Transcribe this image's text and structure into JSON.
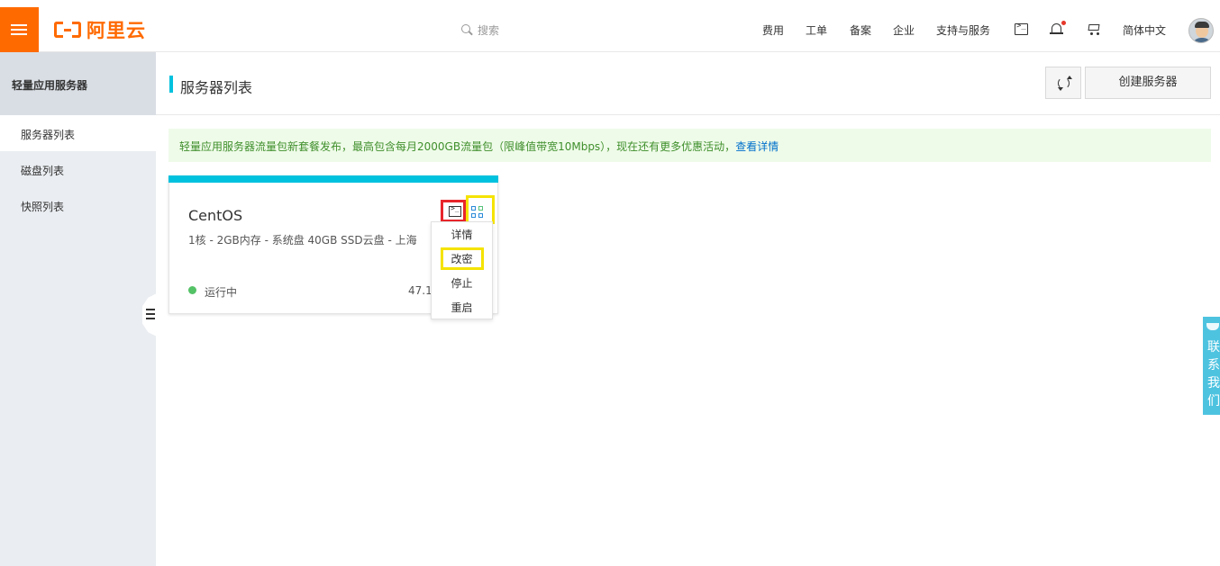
{
  "header": {
    "logo_text": "阿里云",
    "search_placeholder": "搜索",
    "nav": [
      "费用",
      "工单",
      "备案",
      "企业",
      "支持与服务"
    ],
    "language": "简体中文"
  },
  "sidebar": {
    "title": "轻量应用服务器",
    "items": [
      {
        "label": "服务器列表",
        "active": true
      },
      {
        "label": "磁盘列表",
        "active": false
      },
      {
        "label": "快照列表",
        "active": false
      }
    ]
  },
  "main": {
    "page_title": "服务器列表",
    "create_button": "创建服务器",
    "notice_text": "轻量应用服务器流量包新套餐发布，最高包含每月2000GB流量包（限峰值带宽10Mbps），现在还有更多优惠活动，",
    "notice_link": "查看详情"
  },
  "server_card": {
    "name": "CentOS",
    "spec": "1核 - 2GB内存 - 系统盘 40GB SSD云盘 - 上海",
    "status": "运行中",
    "ip": "47.1",
    "menu": [
      "详情",
      "改密",
      "停止",
      "重启"
    ]
  },
  "contact": {
    "label": "联系我们"
  },
  "colors": {
    "brand": "#ff6a00",
    "accent": "#00c1de",
    "status_running": "#54c266",
    "highlight_red": "#e8262b",
    "highlight_yellow": "#f5e300"
  }
}
